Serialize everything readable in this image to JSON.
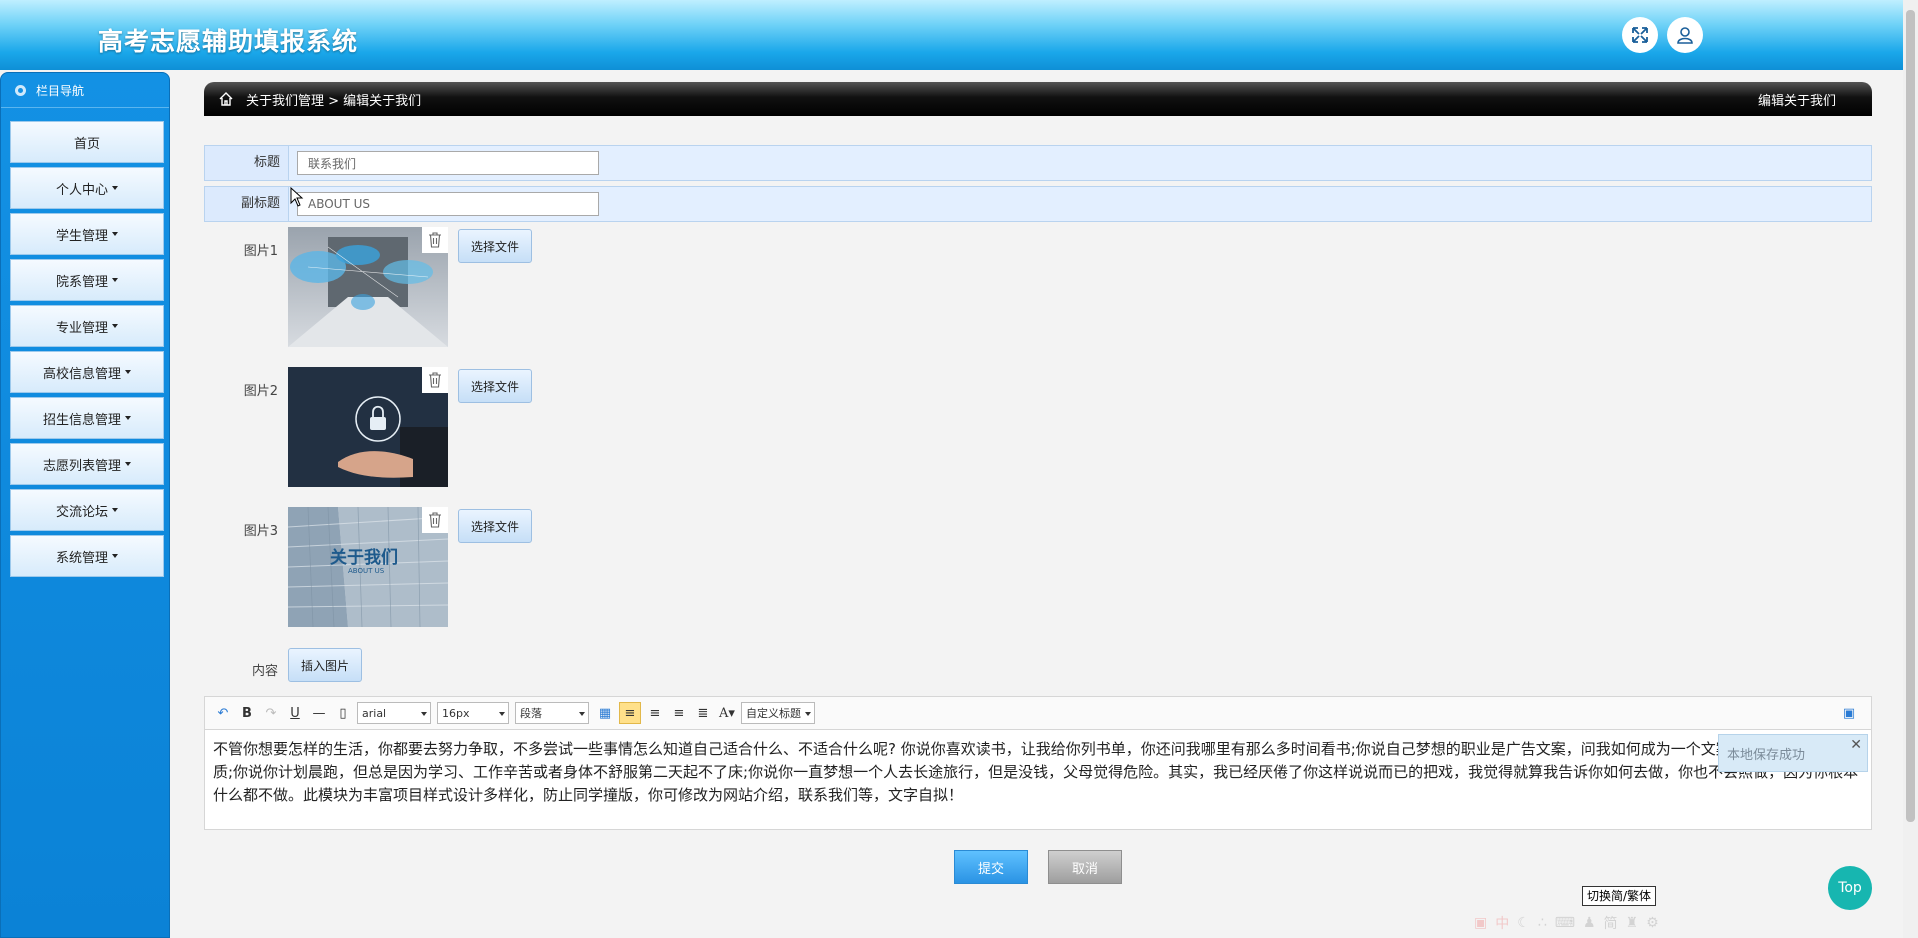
{
  "header": {
    "title": "高考志愿辅助填报系统",
    "fullscreen_icon": "expand-arrows-icon",
    "user_icon": "user-icon"
  },
  "sidebar": {
    "nav_title": "栏目导航",
    "items": [
      {
        "label": "首页",
        "has_caret": false
      },
      {
        "label": "个人中心",
        "has_caret": true
      },
      {
        "label": "学生管理",
        "has_caret": true
      },
      {
        "label": "院系管理",
        "has_caret": true
      },
      {
        "label": "专业管理",
        "has_caret": true
      },
      {
        "label": "高校信息管理",
        "has_caret": true
      },
      {
        "label": "招生信息管理",
        "has_caret": true
      },
      {
        "label": "志愿列表管理",
        "has_caret": true
      },
      {
        "label": "交流论坛",
        "has_caret": true
      },
      {
        "label": "系统管理",
        "has_caret": true
      }
    ]
  },
  "breadcrumb": {
    "path": "关于我们管理 > 编辑关于我们",
    "right_title": "编辑关于我们"
  },
  "form": {
    "title_label": "标题",
    "title_value": "联系我们",
    "subtitle_label": "副标题",
    "subtitle_value": "ABOUT US",
    "images": [
      {
        "label": "图片1",
        "choose": "选择文件"
      },
      {
        "label": "图片2",
        "choose": "选择文件"
      },
      {
        "label": "图片3",
        "choose": "选择文件",
        "caption": "关于我们",
        "caption_sub": "ABOUT US"
      }
    ],
    "content_label": "内容",
    "insert_image": "插入图片"
  },
  "toolbar": {
    "font_family": "arial",
    "font_size": "16px",
    "paragraph": "段落",
    "custom_title": "自定义标题"
  },
  "editor": {
    "content": "不管你想要怎样的生活，你都要去努力争取，不多尝试一些事情怎么知道自己适合什么、不适合什么呢? 你说你喜欢读书，让我给你列书单，你还问我哪里有那么多时间看书;你说自己梦想的职业是广告文案，问我如何成为一个文案，应该具备哪些素质;你说你计划晨跑，但总是因为学习、工作辛苦或者身体不舒服第二天起不了床;你说你一直梦想一个人去长途旅行，但是没钱，父母觉得危险。其实，我已经厌倦了你这样说说而已的把戏，我觉得就算我告诉你如何去做，你也不会照做，因为你根本什么都不做。此模块为丰富项目样式设计多样化，防止同学撞版，你可修改为网站介绍，联系我们等，文字自拟！"
  },
  "toast": {
    "message": "本地保存成功",
    "close": "✕"
  },
  "actions": {
    "submit": "提交",
    "cancel": "取消"
  },
  "tooltip": {
    "text": "切换简/繁体"
  },
  "top_button": {
    "label": "Top"
  },
  "ime_bar": {
    "items": [
      "中",
      "简"
    ]
  }
}
